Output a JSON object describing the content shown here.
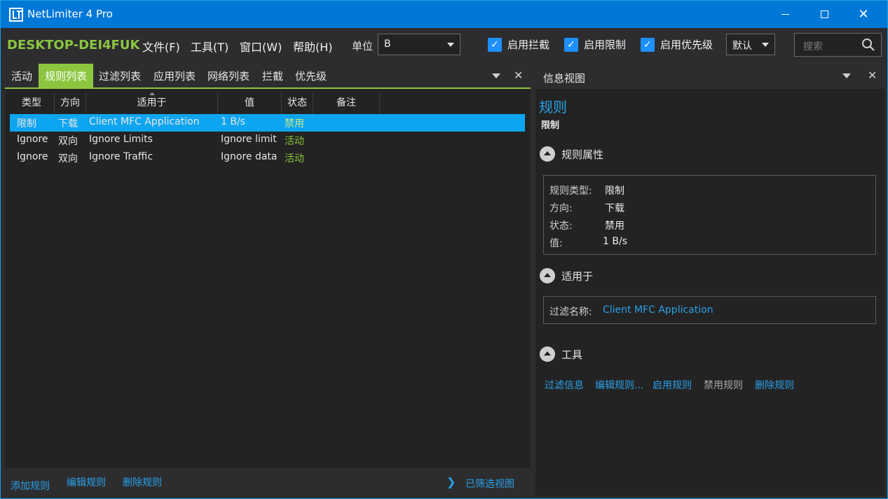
{
  "window": {
    "title": "NetLimiter 4 Pro"
  },
  "menubar": {
    "hostname": "DESKTOP-DEI4FUK",
    "items": [
      "文件(F)",
      "工具(T)",
      "窗口(W)",
      "帮助(H)"
    ],
    "unit_label": "单位",
    "unit_value": "B",
    "checkboxes": [
      "启用拦截",
      "启用限制",
      "启用优先级"
    ],
    "priority_value": "默认",
    "search_placeholder": "搜索"
  },
  "left": {
    "tabs": [
      "活动",
      "规则列表",
      "过滤列表",
      "应用列表",
      "网络列表",
      "拦截",
      "优先级"
    ],
    "active_tab": 1,
    "columns": [
      "类型",
      "方向",
      "适用于",
      "值",
      "状态",
      "备注"
    ],
    "rows": [
      {
        "type": "限制",
        "dir": "下载",
        "applies": "Client MFC Application",
        "value": "1 B/s",
        "status": "禁用",
        "note": ""
      },
      {
        "type": "Ignore",
        "dir": "双向",
        "applies": "Ignore Limits",
        "value": "Ignore limit",
        "status": "活动",
        "note": ""
      },
      {
        "type": "Ignore",
        "dir": "双向",
        "applies": "Ignore Traffic",
        "value": "Ignore data",
        "status": "活动",
        "note": ""
      }
    ],
    "footer": {
      "add": "添加规则",
      "edit": "编辑规则",
      "delete": "删除规则",
      "filtered_view": "已筛选视图"
    }
  },
  "right": {
    "title": "信息视图",
    "heading": "规则",
    "subheading": "限制",
    "section_props": "规则属性",
    "props": [
      {
        "k": "规则类型:",
        "v": "限制"
      },
      {
        "k": "方向:",
        "v": "下载"
      },
      {
        "k": "状态:",
        "v": "禁用"
      },
      {
        "k": "值:",
        "v": "1 B/s"
      }
    ],
    "section_applies": "适用于",
    "filter_name_label": "过滤名称:",
    "filter_name_value": "Client MFC Application",
    "section_tools": "工具",
    "tools": [
      "过滤信息",
      "编辑规则...",
      "启用规则",
      "禁用规则",
      "删除规则"
    ]
  },
  "colors": {
    "accent_green": "#8cc63f",
    "accent_blue": "#0078d7",
    "link_blue": "#2aa1e8",
    "selection": "#0ea5f0"
  }
}
